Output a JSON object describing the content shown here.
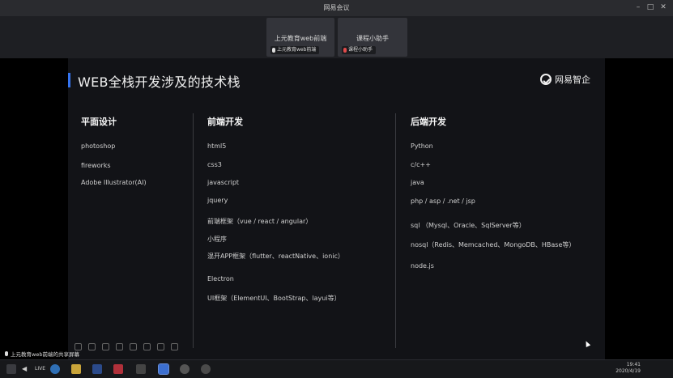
{
  "window": {
    "title": "网易会议"
  },
  "participants": [
    {
      "name": "上元教育web前端",
      "tag": "上元教育web前端",
      "mic": "on"
    },
    {
      "name": "课程小助手",
      "tag": "课程小助手",
      "mic": "muted"
    }
  ],
  "slide": {
    "title": "WEB全栈开发涉及的技术栈",
    "logo_text": "网易智企",
    "columns": [
      {
        "heading": "平面设计",
        "items": [
          "photoshop",
          "fireworks",
          "Adobe Illustrator(AI)"
        ]
      },
      {
        "heading": "前端开发",
        "items": [
          "html5",
          "css3",
          "javascript",
          "jquery",
          "前端框架（vue / react / angular）",
          "小程序",
          "混开APP框架（flutter、reactNative、ionic）",
          "Electron",
          "UI框架（ElementUI、BootStrap、layui等）"
        ]
      },
      {
        "heading": "后端开发",
        "items": [
          "Python",
          "c/c++",
          "java",
          "php / asp / .net / jsp",
          "sql （Mysql、Oracle、SqlServer等）",
          "nosql（Redis、Memcached、MongoDB、HBase等）",
          "node.js"
        ]
      }
    ]
  },
  "share_label": "上元教育web前端的共享屏幕",
  "taskbar": {
    "live": "LIVE",
    "time": "19:41",
    "date": "2020/4/19"
  },
  "colors": {
    "accent": "#3574f0",
    "slide_bg": "#121317"
  }
}
